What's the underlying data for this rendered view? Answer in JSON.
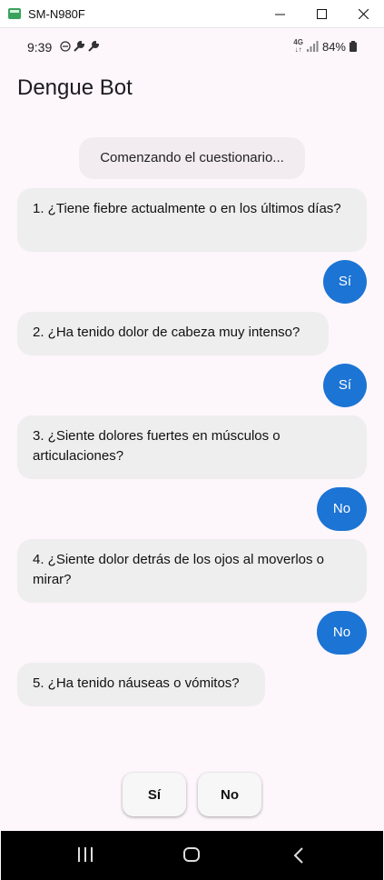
{
  "window": {
    "title": "SM-N980F"
  },
  "status_bar": {
    "time": "9:39",
    "network": "4G",
    "battery": "84%"
  },
  "app": {
    "title": "Dengue Bot"
  },
  "chat": {
    "system_message": "Comenzando el cuestionario...",
    "messages": [
      {
        "role": "bot",
        "text": "1. ¿Tiene fiebre actualmente o en los últimos días?"
      },
      {
        "role": "user",
        "text": "Sí"
      },
      {
        "role": "bot",
        "text": "2. ¿Ha tenido dolor de cabeza muy intenso?"
      },
      {
        "role": "user",
        "text": "Sí"
      },
      {
        "role": "bot",
        "text": "3. ¿Siente dolores fuertes en músculos o articulaciones?"
      },
      {
        "role": "user",
        "text": "No"
      },
      {
        "role": "bot",
        "text": "4. ¿Siente dolor detrás de los ojos al moverlos o mirar?"
      },
      {
        "role": "user",
        "text": "No"
      },
      {
        "role": "bot",
        "text": "5. ¿Ha tenido náuseas o vómitos?"
      }
    ]
  },
  "answers": {
    "yes_label": "Sí",
    "no_label": "No"
  },
  "colors": {
    "background": "#fdf6fb",
    "user_bubble": "#1c74d4",
    "bot_bubble": "#eeeeee"
  }
}
